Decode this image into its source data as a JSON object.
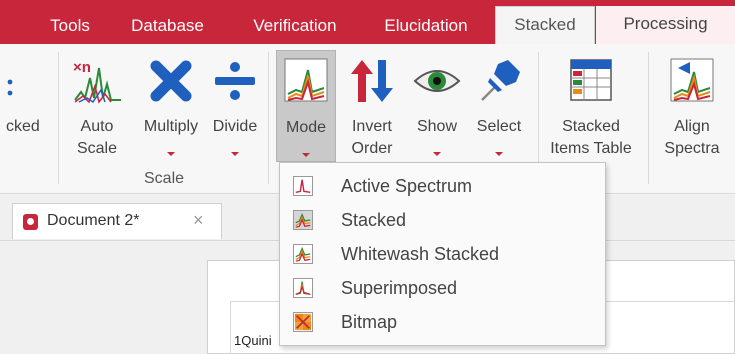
{
  "tabs": [
    "Tools",
    "Database",
    "Verification",
    "Elucidation",
    "Stacked",
    "Processing"
  ],
  "active_tab": "Stacked",
  "ribbon": {
    "partial_left_label": "cked",
    "auto_scale": [
      "Auto",
      "Scale"
    ],
    "multiply": "Multiply",
    "divide": "Divide",
    "group_scale": "Scale",
    "mode": "Mode",
    "invert_order": [
      "Invert",
      "Order"
    ],
    "show": "Show",
    "select": "Select",
    "stacked_items_table": [
      "Stacked",
      "Items Table"
    ],
    "align_spectra": [
      "Align",
      "Spectra"
    ]
  },
  "document_tab": {
    "name": "Document 2*",
    "close": "×"
  },
  "canvas": {
    "partial_text": "1Quini"
  },
  "mode_menu": [
    "Active Spectrum",
    "Stacked",
    "Whitewash Stacked",
    "Superimposed",
    "Bitmap"
  ],
  "colors": {
    "accent": "#c8263a",
    "tool_blue": "#1f5fbd"
  }
}
